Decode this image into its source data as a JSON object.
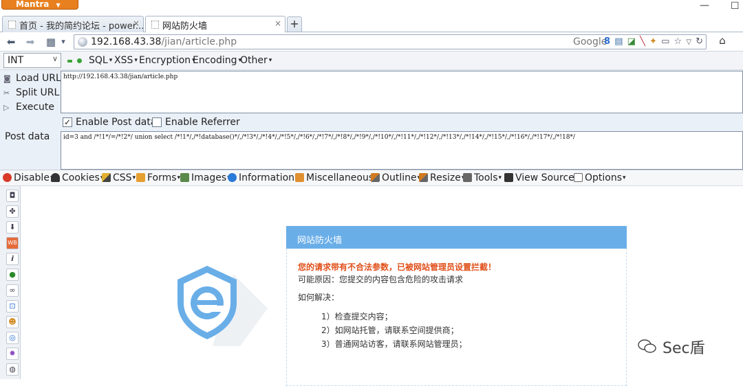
{
  "window": {
    "app_menu": "Mantra",
    "minimize": "—",
    "maximize": "☐"
  },
  "tabs": [
    {
      "label": "首页 - 我的简约论坛 - power...",
      "close": "×"
    },
    {
      "label": "网站防火墙",
      "close": "×"
    }
  ],
  "new_tab": "+",
  "nav": {
    "back": "⬅",
    "forward": "➡",
    "grid": "▦",
    "dropdown": "▾",
    "url_host": "192.168.43.38",
    "url_path": "/jian/article.php",
    "search_engine": "Google",
    "home": "⌂"
  },
  "hackbar": {
    "type_select": "INT",
    "menus": [
      "SQL",
      "XSS",
      "Encryption",
      "Encoding",
      "Other"
    ],
    "load_url": "Load URL",
    "split_url": "Split URL",
    "execute": "Execute",
    "url_value": "http://192.168.43.38/jian/article.php",
    "enable_post": "Enable Post data",
    "enable_post_checked": "✓",
    "enable_referrer": "Enable Referrer",
    "enable_referrer_checked": "",
    "post_label": "Post data",
    "post_value": "id=3 and /*!1*/=/*!2*/ union select /*!1*/,/*!database()*/,/*!3*/,/*!4*/,/*!5*/,/*!6*/,/*!7*/,/*!8*/,/*!9*/,/*!10*/,/*!11*/,/*!12*/,/*!13*/,/*!14*/,/*!15*/,/*!16*/,/*!17*/,/*!18*/"
  },
  "webdev": {
    "items": [
      "Disable",
      "Cookies",
      "CSS",
      "Forms",
      "Images",
      "Information",
      "Miscellaneous",
      "Outline",
      "Resize",
      "Tools",
      "View Source",
      "Options"
    ]
  },
  "firewall": {
    "title": "网站防火墙",
    "warning": "您的请求带有不合法参数，已被网站管理员设置拦截！",
    "reason": "可能原因：您提交的内容包含危险的攻击请求",
    "howto": "如何解决：",
    "steps": [
      "1）检查提交内容；",
      "2）如网站托管，请联系空间提供商；",
      "3）普通网站访客，请联系网站管理员；"
    ]
  },
  "watermark": "Sec盾",
  "colors": {
    "accent_blue": "#6aaee8",
    "warning_red": "#e04f1a",
    "mantra_orange": "#e8801f"
  }
}
